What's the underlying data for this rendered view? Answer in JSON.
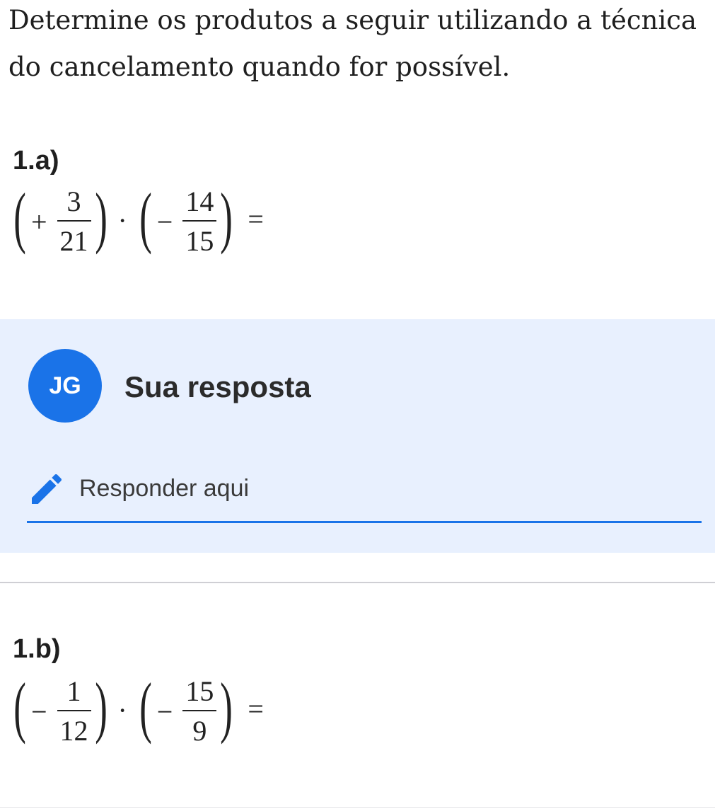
{
  "intro": "Determine os produtos a seguir utilizando a técnica do cancelamento quando for possível.",
  "questions": [
    {
      "label": "1.a)",
      "expression": {
        "f1": {
          "sign": "+",
          "num": "3",
          "den": "21"
        },
        "f2": {
          "sign": "−",
          "num": "14",
          "den": "15"
        },
        "operator": "·",
        "equals": "="
      }
    },
    {
      "label": "1.b)",
      "expression": {
        "f1": {
          "sign": "−",
          "num": "1",
          "den": "12"
        },
        "f2": {
          "sign": "−",
          "num": "15",
          "den": "9"
        },
        "operator": "·",
        "equals": "="
      }
    }
  ],
  "answer": {
    "avatar_initials": "JG",
    "title": "Sua resposta",
    "placeholder": "Responder aqui",
    "pencil_icon": "pencil-icon",
    "accent": "#1a73e8",
    "panel_bg": "#e8f0fe"
  }
}
